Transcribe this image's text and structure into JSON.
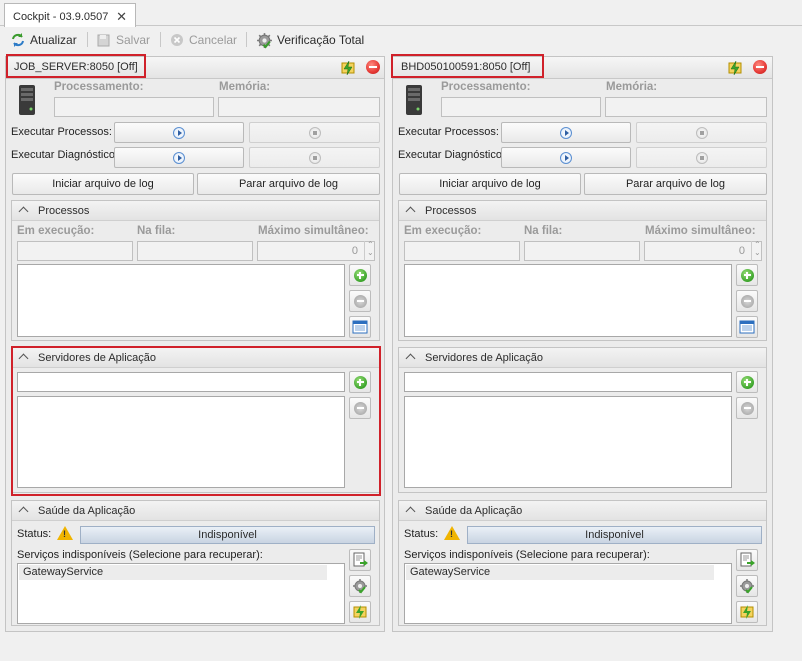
{
  "tab": {
    "title": "Cockpit - 03.9.0507",
    "close": "✕"
  },
  "toolbar": {
    "refresh": "Atualizar",
    "save": "Salvar",
    "cancel": "Cancelar",
    "check": "Verificação Total"
  },
  "servers": [
    {
      "name": "JOB_SERVER:8050 [Off]",
      "processing_label": "Processamento:",
      "memory_label": "Memória:",
      "run_processes": "Executar Processos:",
      "run_diagnostics": "Executar Diagnóstico:",
      "start_log": "Iniciar arquivo de log",
      "stop_log": "Parar arquivo de log",
      "processes": {
        "title": "Processos",
        "running": "Em execução:",
        "queued": "Na fila:",
        "max": "Máximo simultâneo:",
        "max_value": "0"
      },
      "app_servers": {
        "title": "Servidores de Aplicação"
      },
      "health": {
        "title": "Saúde da Aplicação",
        "status_label": "Status:",
        "status_value": "Indisponível",
        "services_label": "Serviços indisponíveis (Selecione para recuperar):",
        "services": [
          "GatewayService"
        ]
      }
    },
    {
      "name": "BHD050100591:8050 [Off]",
      "processing_label": "Processamento:",
      "memory_label": "Memória:",
      "run_processes": "Executar Processos:",
      "run_diagnostics": "Executar Diagnóstico:",
      "start_log": "Iniciar arquivo de log",
      "stop_log": "Parar arquivo de log",
      "processes": {
        "title": "Processos",
        "running": "Em execução:",
        "queued": "Na fila:",
        "max": "Máximo simultâneo:",
        "max_value": "0"
      },
      "app_servers": {
        "title": "Servidores de Aplicação"
      },
      "health": {
        "title": "Saúde da Aplicação",
        "status_label": "Status:",
        "status_value": "Indisponível",
        "services_label": "Serviços indisponíveis (Selecione para recuperar):",
        "services": [
          "GatewayService"
        ]
      }
    }
  ],
  "colors": {
    "highlight": "#d0212a",
    "status_bar": "#c9d4e2",
    "warning": "#f0b400"
  },
  "icons": [
    "refresh-icon",
    "save-icon",
    "cancel-icon",
    "gear-check-icon",
    "server-icon",
    "lightning-icon",
    "stop-icon",
    "play-icon",
    "add-icon",
    "remove-icon",
    "list-icon",
    "warning-icon"
  ]
}
